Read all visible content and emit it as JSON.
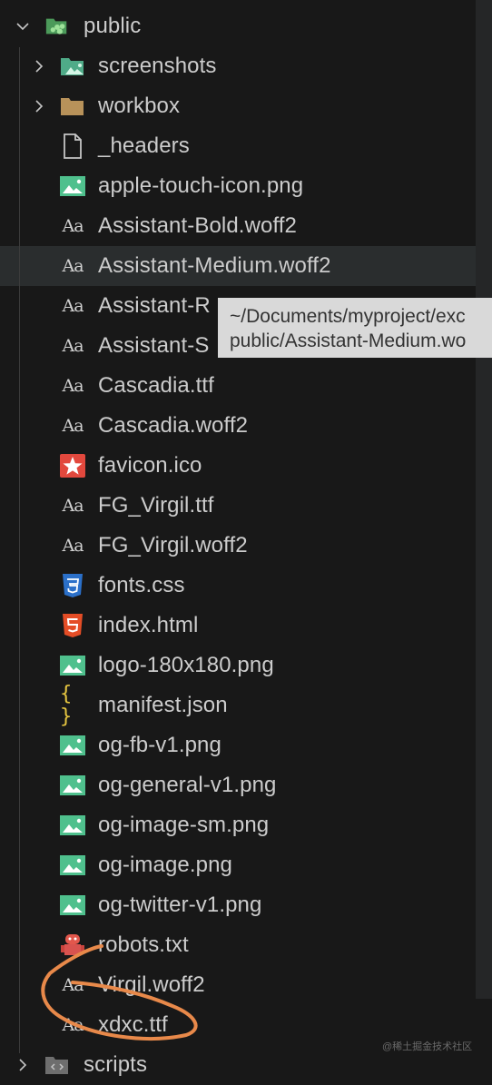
{
  "explorer": {
    "root_folder": {
      "name": "public",
      "expanded": true,
      "icon": "public-folder-icon"
    },
    "items": [
      {
        "name": "screenshots",
        "type": "folder",
        "icon": "image-folder-icon",
        "expanded": false
      },
      {
        "name": "workbox",
        "type": "folder",
        "icon": "folder-icon",
        "expanded": false
      },
      {
        "name": "_headers",
        "type": "file",
        "icon": "file-icon"
      },
      {
        "name": "apple-touch-icon.png",
        "type": "file",
        "icon": "image-icon"
      },
      {
        "name": "Assistant-Bold.woff2",
        "type": "file",
        "icon": "font-icon"
      },
      {
        "name": "Assistant-Medium.woff2",
        "type": "file",
        "icon": "font-icon",
        "hovered": true
      },
      {
        "name": "Assistant-R",
        "type": "file",
        "icon": "font-icon"
      },
      {
        "name": "Assistant-S",
        "type": "file",
        "icon": "font-icon"
      },
      {
        "name": "Cascadia.ttf",
        "type": "file",
        "icon": "font-icon"
      },
      {
        "name": "Cascadia.woff2",
        "type": "file",
        "icon": "font-icon"
      },
      {
        "name": "favicon.ico",
        "type": "file",
        "icon": "favicon-star-icon"
      },
      {
        "name": "FG_Virgil.ttf",
        "type": "file",
        "icon": "font-icon"
      },
      {
        "name": "FG_Virgil.woff2",
        "type": "file",
        "icon": "font-icon"
      },
      {
        "name": "fonts.css",
        "type": "file",
        "icon": "css3-icon"
      },
      {
        "name": "index.html",
        "type": "file",
        "icon": "html5-icon"
      },
      {
        "name": "logo-180x180.png",
        "type": "file",
        "icon": "image-icon"
      },
      {
        "name": "manifest.json",
        "type": "file",
        "icon": "json-braces-icon"
      },
      {
        "name": "og-fb-v1.png",
        "type": "file",
        "icon": "image-icon"
      },
      {
        "name": "og-general-v1.png",
        "type": "file",
        "icon": "image-icon"
      },
      {
        "name": "og-image-sm.png",
        "type": "file",
        "icon": "image-icon"
      },
      {
        "name": "og-image.png",
        "type": "file",
        "icon": "image-icon"
      },
      {
        "name": "og-twitter-v1.png",
        "type": "file",
        "icon": "image-icon"
      },
      {
        "name": "robots.txt",
        "type": "file",
        "icon": "robot-icon"
      },
      {
        "name": "Virgil.woff2",
        "type": "file",
        "icon": "font-icon"
      },
      {
        "name": "xdxc.ttf",
        "type": "file",
        "icon": "font-icon"
      }
    ],
    "next_folder": {
      "name": "scripts",
      "expanded": false,
      "icon": "scripts-folder-icon"
    }
  },
  "tooltip": {
    "line1": "~/Documents/myproject/exc",
    "line2": "public/Assistant-Medium.wo"
  },
  "font_icon_glyph": "Aa",
  "json_icon_glyph": "{ }",
  "colors": {
    "background": "#181818",
    "hover_row": "#2a2d2e",
    "image_green": "#4fc08d",
    "folder_tan": "#c09553",
    "annotation_orange": "#e8894a",
    "tooltip_bg": "#d9d9d9"
  },
  "watermark": "@稀土掘金技术社区"
}
